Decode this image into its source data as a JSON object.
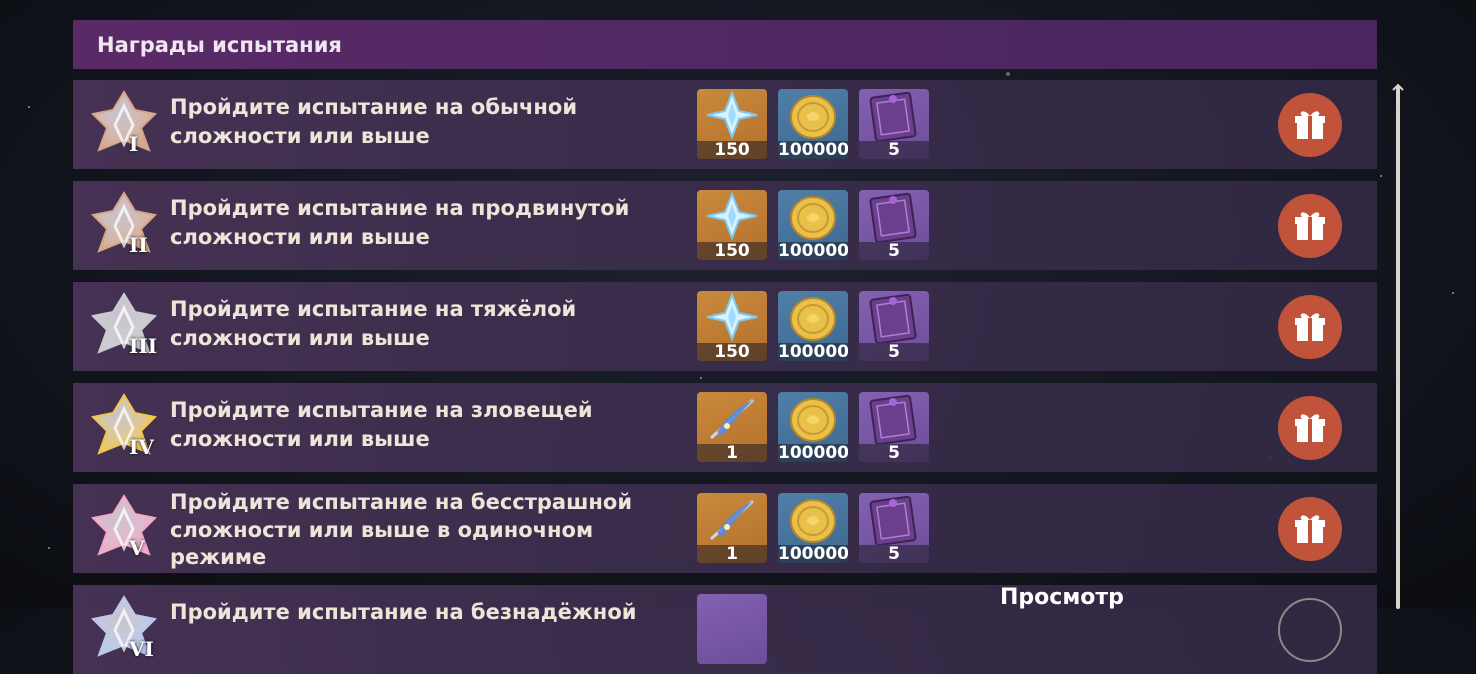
{
  "header": {
    "title": "Награды испытания"
  },
  "view_label": "Просмотр",
  "rows": [
    {
      "rank": "I",
      "emblem_color": "#d7a587",
      "text_lines": [
        "Пройдите испытание на обычной",
        "сложности или выше"
      ],
      "rewards": [
        {
          "icon": "primogem-icon",
          "qty": "150"
        },
        {
          "icon": "mora-icon",
          "qty": "100000"
        },
        {
          "icon": "exp-book-icon",
          "qty": "5"
        }
      ]
    },
    {
      "rank": "II",
      "emblem_color": "#d7a587",
      "text_lines": [
        "Пройдите испытание на продвинутой",
        "сложности или выше"
      ],
      "rewards": [
        {
          "icon": "primogem-icon",
          "qty": "150"
        },
        {
          "icon": "mora-icon",
          "qty": "100000"
        },
        {
          "icon": "exp-book-icon",
          "qty": "5"
        }
      ]
    },
    {
      "rank": "III",
      "emblem_color": "#c9cbd0",
      "text_lines": [
        "Пройдите испытание на тяжёлой",
        "сложности или выше"
      ],
      "rewards": [
        {
          "icon": "primogem-icon",
          "qty": "150"
        },
        {
          "icon": "mora-icon",
          "qty": "100000"
        },
        {
          "icon": "exp-book-icon",
          "qty": "5"
        }
      ]
    },
    {
      "rank": "IV",
      "emblem_color": "#f0c64a",
      "text_lines": [
        "Пройдите испытание на зловещей",
        "сложности или выше"
      ],
      "rewards": [
        {
          "icon": "feather-icon",
          "qty": "1"
        },
        {
          "icon": "mora-icon",
          "qty": "100000"
        },
        {
          "icon": "exp-book-icon",
          "qty": "5"
        }
      ]
    },
    {
      "rank": "V",
      "emblem_color": "#f2a8c6",
      "text_lines": [
        "Пройдите испытание на бесстрашной",
        "сложности или выше в одиночном",
        "режиме"
      ],
      "rewards": [
        {
          "icon": "feather-icon",
          "qty": "1"
        },
        {
          "icon": "mora-icon",
          "qty": "100000"
        },
        {
          "icon": "exp-book-icon",
          "qty": "5"
        }
      ]
    },
    {
      "rank": "VI",
      "emblem_color": "#b8c8ef",
      "text_lines": [
        "Пройдите испытание на безнадёжной"
      ],
      "rewards": []
    }
  ],
  "colors": {
    "header": "#5a2a67",
    "claim_button": "#c0533a"
  }
}
